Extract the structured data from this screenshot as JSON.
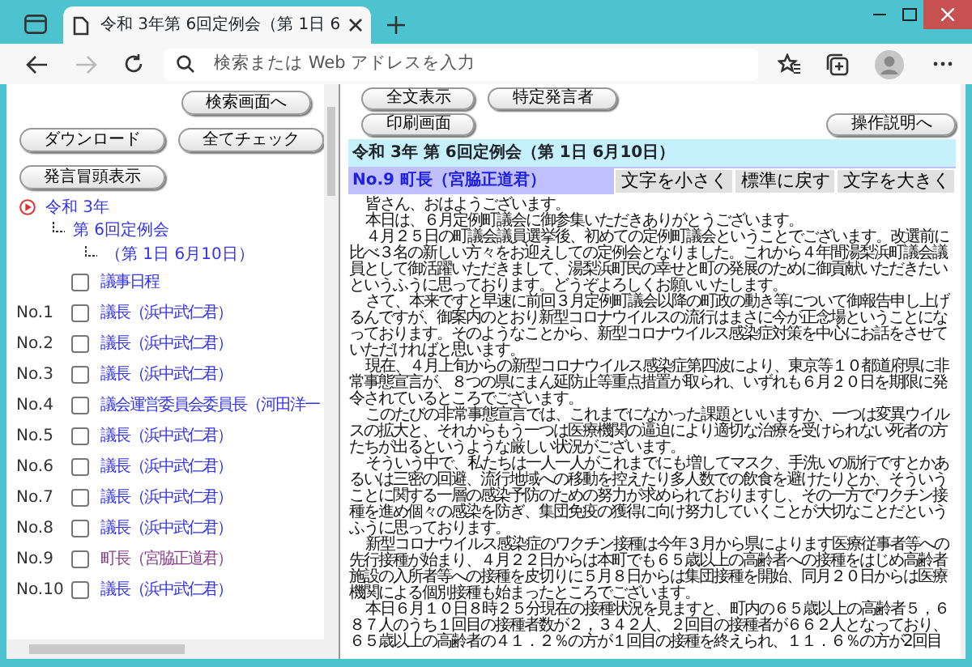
{
  "browser": {
    "tab_title": "令和 3年第 6回定例会（第 1日 6",
    "address_placeholder": "検索または Web アドレスを入力",
    "forward_disabled": true
  },
  "left_pane": {
    "search_button": "検索画面へ",
    "buttons": [
      "ダウンロード",
      "全てチェック"
    ],
    "head_button": "発言冒頭表示",
    "tree": [
      {
        "label": "令和 3年",
        "children": [
          {
            "label": "第 6回定例会",
            "children": [
              {
                "label": "（第 1日 6月10日）"
              }
            ]
          }
        ]
      }
    ],
    "speeches": [
      {
        "label": "議事日程",
        "checked": false,
        "selected": false
      },
      {
        "number": "No.1",
        "label": "議長（浜中武仁君）",
        "checked": false,
        "selected": false
      },
      {
        "number": "No.2",
        "label": "議長（浜中武仁君）",
        "checked": false,
        "selected": false
      },
      {
        "number": "No.3",
        "label": "議長（浜中武仁君）",
        "checked": false,
        "selected": false
      },
      {
        "number": "No.4",
        "label": "議会運営委員会委員長（河田洋一",
        "checked": false,
        "selected": false
      },
      {
        "number": "No.5",
        "label": "議長（浜中武仁君）",
        "checked": false,
        "selected": false
      },
      {
        "number": "No.6",
        "label": "議長（浜中武仁君）",
        "checked": false,
        "selected": false
      },
      {
        "number": "No.7",
        "label": "議長（浜中武仁君）",
        "checked": false,
        "selected": false
      },
      {
        "number": "No.8",
        "label": "議長（浜中武仁君）",
        "checked": false,
        "selected": false
      },
      {
        "number": "No.9",
        "label": "町長（宮脇正道君）",
        "checked": false,
        "selected": true
      },
      {
        "number": "No.10",
        "label": "議長（浜中武仁君）",
        "checked": false,
        "selected": false
      }
    ]
  },
  "right_pane": {
    "button_rows": [
      [
        "全文表示",
        "特定発言者"
      ],
      [
        "印刷画面"
      ]
    ],
    "help_button": "操作説明へ",
    "meeting_heading": "令和 3年 第 6回定例会（第 1日 6月10日）",
    "speaker": "No.9 町長（宮脇正道君）",
    "font_buttons": [
      "文字を小さく",
      "標準に戻す",
      "文字を大きく"
    ],
    "paragraphs": [
      "皆さん、おはようございます。",
      "本日は、６月定例町議会に御参集いただきありがとうございます。",
      "４月２５日の町議会議員選挙後、初めての定例町議会ということでございます。改選前に比べ３名の新しい方々をお迎えしての定例会となりました。これから４年間湯梨浜町議会議員として御活躍いただきまして、湯梨浜町民の幸せと町の発展のために御貢献いただきたいというふうに思っております。どうぞよろしくお願いいたします。",
      "さて、本来ですと早速に前回３月定例町議会以降の町政の動き等について御報告申し上げるんですが、御案内のとおり新型コロナウイルスの流行はまさに今が正念場ということになっております。そのようなことから、新型コロナウイルス感染症対策を中心にお話をさせていただければと思います。",
      "現在、４月上旬からの新型コロナウイルス感染症第四波により、東京等１０都道府県に非常事態宣言が、８つの県にまん延防止等重点措置が取られ、いずれも６月２０日を期限に発令されているところでございます。",
      "このたびの非常事態宣言では、これまでになかった課題といいますか、一つは変異ウイルスの拡大と、それからもう一つは医療機関の逼迫により適切な治療を受けられない死者の方たちが出るというような厳しい状況がございます。",
      "そういう中で、私たちは一人一人がこれまでにも増してマスク、手洗いの励行ですとかあるいは三密の回避、流行地域への移動を控えたり多人数での飲食を避けたりとか、そういうことに関する一層の感染予防のための努力が求められておりますし、その一方でワクチン接種を進め個々の感染を防ぎ、集団免疫の獲得に向け努力していくことが大切なことだというふうに思っております。",
      "新型コロナウイルス感染症のワクチン接種は今年３月から県によります医療従事者等への先行接種が始まり、４月２２日からは本町でも６５歳以上の高齢者への接種をはじめ高齢者施設の入所者等への接種を皮切りに５月８日からは集団接種を開始、同月２０日からは医療機関による個別接種も始まったところでございます。",
      "本日６月１０日８時２５分現在の接種状況を見ますと、町内の６５歳以上の高齢者５，６８７人のうち１回目の接種者数が２，３４２人、２回目の接種者が６６２人となっており、６５歳以上の高齢者の４１．２％の方が１回目の接種を終えられ、１１．６％の方が2回目"
    ]
  }
}
